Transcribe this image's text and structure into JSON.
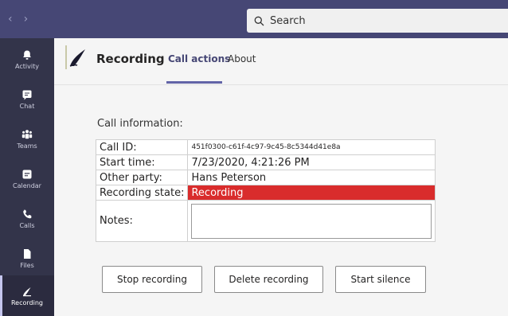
{
  "topbar": {
    "back_icon": "chevron-left-icon",
    "forward_icon": "chevron-right-icon",
    "search_placeholder": "Search"
  },
  "rail": {
    "items": [
      {
        "label": "Activity",
        "icon": "bell-icon"
      },
      {
        "label": "Chat",
        "icon": "chat-icon"
      },
      {
        "label": "Teams",
        "icon": "teams-icon"
      },
      {
        "label": "Calendar",
        "icon": "calendar-icon"
      },
      {
        "label": "Calls",
        "icon": "phone-icon"
      },
      {
        "label": "Files",
        "icon": "file-icon"
      },
      {
        "label": "Recording",
        "icon": "recording-app-icon",
        "active": true
      }
    ]
  },
  "app": {
    "title": "Recording",
    "tabs": [
      {
        "label": "Call actions",
        "active": true
      },
      {
        "label": "About"
      }
    ]
  },
  "call_info": {
    "heading": "Call information:",
    "rows": [
      {
        "key": "Call ID:",
        "value": "451f0300-c61f-4c97-9c45-8c5344d41e8a"
      },
      {
        "key": "Start time:",
        "value": "7/23/2020, 4:21:26 PM"
      },
      {
        "key": "Other party:",
        "value": "Hans Peterson"
      },
      {
        "key": "Recording state:",
        "value": "Recording"
      },
      {
        "key": "Notes:",
        "value": ""
      }
    ],
    "recording_state_color": "#d92c2c"
  },
  "actions": {
    "stop_label": "Stop recording",
    "delete_label": "Delete recording",
    "silence_label": "Start silence"
  },
  "colors": {
    "topbar": "#464775",
    "rail": "#33344a",
    "accent": "#6264a7"
  }
}
